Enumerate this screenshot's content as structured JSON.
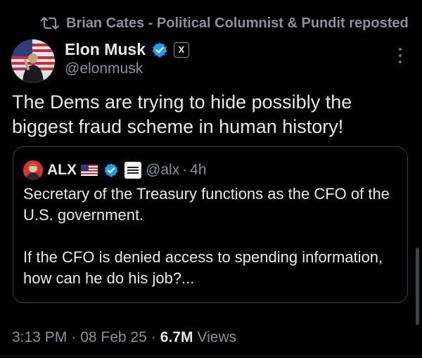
{
  "repost": {
    "icon": "repost-icon",
    "text": "Brian Cates - Political Columnist & Pundit reposted"
  },
  "author": {
    "name": "Elon Musk",
    "handle": "@elonmusk",
    "verified_color": "#1d9bf0",
    "affiliation_badge": "X"
  },
  "tweet": {
    "text": "The Dems are trying to hide possibly the biggest fraud scheme in human history!"
  },
  "quote": {
    "name": "ALX",
    "handle": "@alx",
    "separator": "·",
    "time": "4h",
    "flag_icon": "us-flag-icon",
    "paragraphs": [
      "Secretary of the Treasury functions as the CFO of the U.S. government.",
      "If the CFO is denied access to spending information, how can he do his job?..."
    ]
  },
  "meta": {
    "time": "3:13 PM",
    "sep1": "·",
    "date": "08 Feb 25",
    "sep2": "·",
    "views_count": "6.7M",
    "views_label": "Views"
  },
  "colors": {
    "background": "#000000",
    "text_primary": "#e7e9ea",
    "text_secondary": "#8b9096",
    "verified": "#1d9bf0",
    "quote_border": "#3a3f44"
  }
}
